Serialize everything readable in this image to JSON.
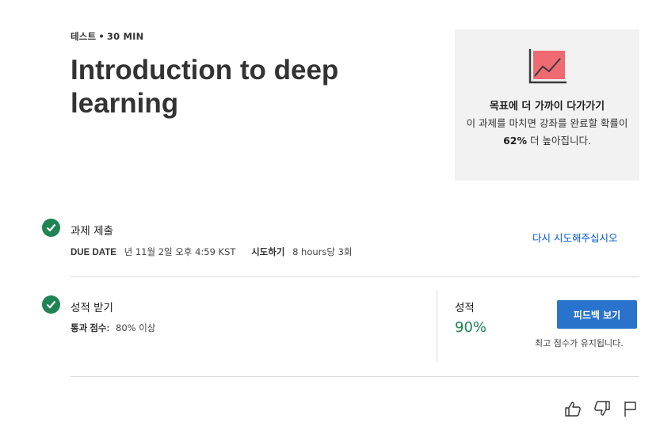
{
  "header": {
    "item_type": "테스트",
    "separator": "•",
    "duration": "30 MIN",
    "title": "Introduction to deep learning"
  },
  "goal_card": {
    "icon": "chart-trend-icon",
    "heading": "목표에 더 가까이 다가가기",
    "text_before": "이 과제를 마치면 강좌를 완료할 확률이 ",
    "highlight": "62%",
    "text_after": " 더 높아집니다."
  },
  "submission": {
    "status_icon": "check-circle-icon",
    "title": "과제 제출",
    "due_label": "DUE DATE",
    "due_value": "년 11월 2일 오후 4:59 KST",
    "attempts_label": "시도하기",
    "attempts_value": "8 hours당 3회",
    "retry_link": "다시 시도해주십시오"
  },
  "grade_section": {
    "status_icon": "check-circle-icon",
    "title": "성적 받기",
    "pass_label": "통과 점수:",
    "pass_value": "80% 이상",
    "grade_label": "성적",
    "grade_value": "90%",
    "feedback_button": "피드백 보기",
    "kept_note": "최고 점수가 유지됩니다."
  },
  "footer": {
    "like_icon": "thumbs-up-icon",
    "dislike_icon": "thumbs-down-icon",
    "flag_icon": "flag-icon"
  },
  "colors": {
    "success_green": "#1f8354",
    "link_blue": "#0056d2",
    "button_blue": "#2a73cc",
    "card_bg": "#f2f2f2",
    "chart_fill": "#ef6a73"
  }
}
